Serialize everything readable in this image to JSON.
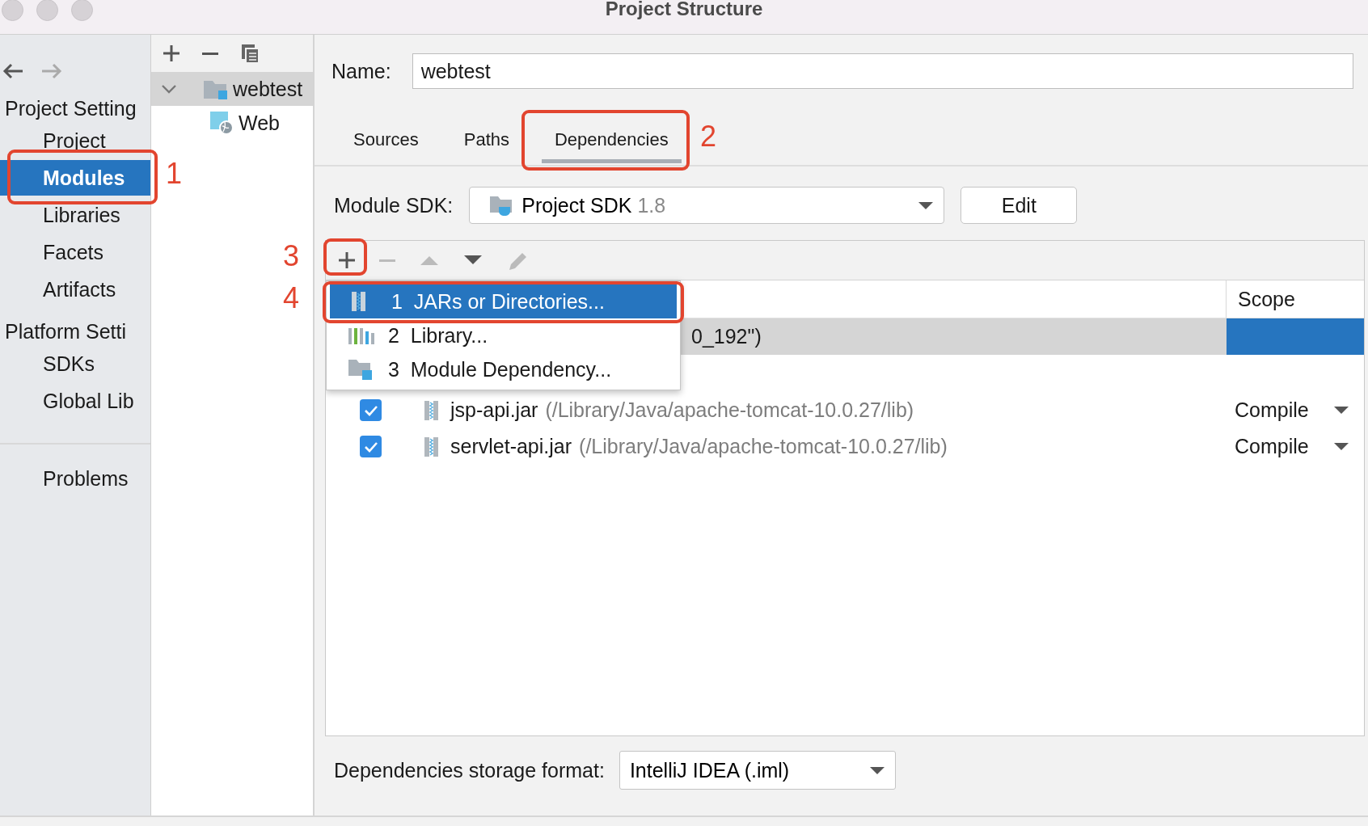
{
  "window": {
    "title": "Project Structure"
  },
  "nav": {
    "history": [
      {
        "kind": "back",
        "disabled": false
      },
      {
        "kind": "forward",
        "disabled": true
      }
    ],
    "sections": [
      {
        "title": "Project Setting",
        "items": [
          {
            "label": "Project",
            "selected": false
          },
          {
            "label": "Modules",
            "selected": true
          },
          {
            "label": "Libraries",
            "selected": false
          },
          {
            "label": "Facets",
            "selected": false
          },
          {
            "label": "Artifacts",
            "selected": false
          }
        ]
      },
      {
        "title": "Platform Setti",
        "items": [
          {
            "label": "SDKs",
            "selected": false
          },
          {
            "label": "Global Lib",
            "selected": false
          }
        ]
      }
    ],
    "footer_items": [
      {
        "label": "Problems",
        "selected": false
      }
    ]
  },
  "module_tree": {
    "toolbar": [
      {
        "kind": "add"
      },
      {
        "kind": "remove"
      },
      {
        "kind": "copy"
      }
    ],
    "items": [
      {
        "label": "webtest",
        "kind": "module",
        "selected": true,
        "expanded": true,
        "children": [
          {
            "label": "Web",
            "kind": "web",
            "selected": false
          }
        ]
      }
    ]
  },
  "name_field": {
    "label": "Name:",
    "value": "webtest"
  },
  "tabs": [
    {
      "label": "Sources",
      "selected": false
    },
    {
      "label": "Paths",
      "selected": false
    },
    {
      "label": "Dependencies",
      "selected": true
    }
  ],
  "module_sdk": {
    "label": "Module SDK:",
    "value": "Project SDK",
    "version": "1.8",
    "button": "Edit"
  },
  "dependencies": {
    "toolbar": [
      {
        "kind": "add",
        "disabled": false
      },
      {
        "kind": "remove",
        "disabled": true
      },
      {
        "kind": "up",
        "disabled": true
      },
      {
        "kind": "down",
        "disabled": false
      },
      {
        "kind": "edit",
        "disabled": true
      }
    ],
    "scope_column": "Scope",
    "rows": [
      {
        "kind": "sdk",
        "name": "0_192\")",
        "selected": true
      },
      {
        "kind": "jar",
        "checked": true,
        "name": "jsp-api.jar",
        "path": "(/Library/Java/apache-tomcat-10.0.27/lib)",
        "scope": "Compile",
        "selected": false
      },
      {
        "kind": "jar",
        "checked": true,
        "name": "servlet-api.jar",
        "path": "(/Library/Java/apache-tomcat-10.0.27/lib)",
        "scope": "Compile",
        "selected": false
      }
    ]
  },
  "add_menu": {
    "items": [
      {
        "number": "1",
        "label": "JARs or Directories...",
        "kind": "jar",
        "selected": true
      },
      {
        "number": "2",
        "label": "Library...",
        "kind": "library",
        "selected": false
      },
      {
        "number": "3",
        "label": "Module Dependency...",
        "kind": "module",
        "selected": false
      }
    ]
  },
  "storage_format": {
    "label": "Dependencies storage format:",
    "value": "IntelliJ IDEA (.iml)"
  },
  "annotations": [
    {
      "number": "1"
    },
    {
      "number": "2"
    },
    {
      "number": "3"
    },
    {
      "number": "4"
    }
  ]
}
